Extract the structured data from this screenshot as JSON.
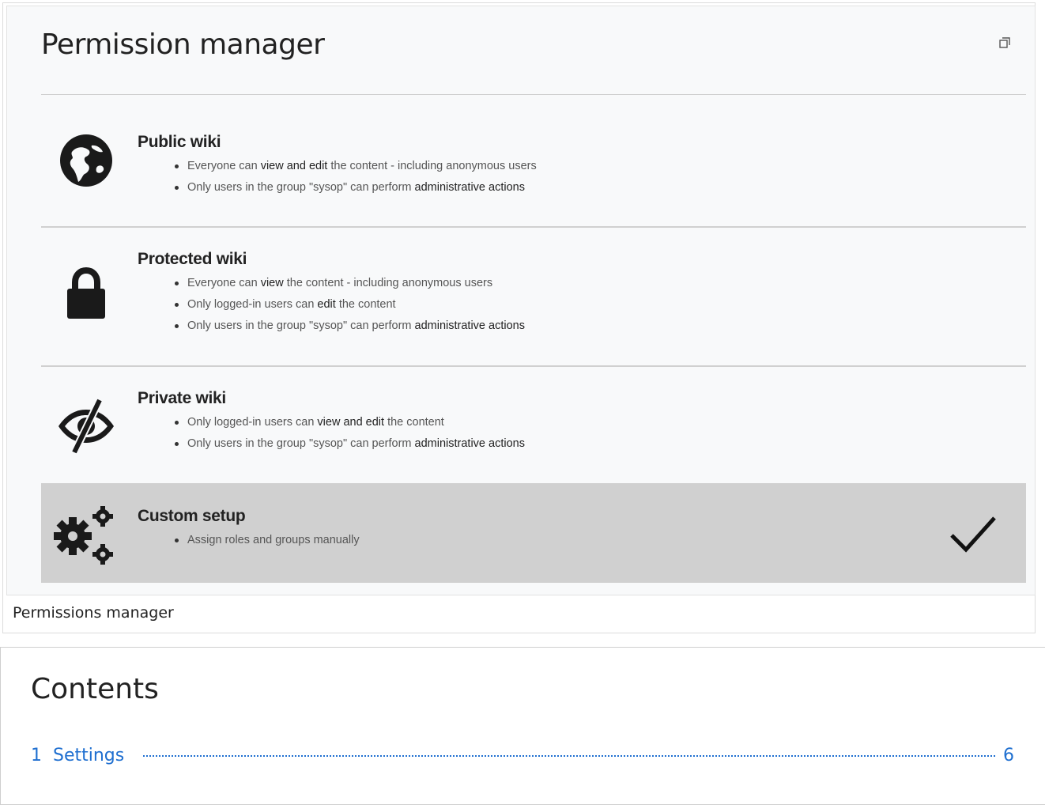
{
  "figure": {
    "title": "Permission manager",
    "caption": "Permissions manager",
    "options": [
      {
        "title": "Public wiki",
        "icon": "globe-icon",
        "items": [
          {
            "pre": "Everyone can ",
            "bold": "view and edit",
            "post": " the content - including anonymous users"
          },
          {
            "pre": "Only users in the group \"sysop\" can perform ",
            "bold": "administrative actions",
            "post": ""
          }
        ]
      },
      {
        "title": "Protected wiki",
        "icon": "lock-icon",
        "items": [
          {
            "pre": "Everyone can ",
            "bold": "view",
            "post": " the content - including anonymous users"
          },
          {
            "pre": "Only logged-in users can ",
            "bold": "edit",
            "post": " the content"
          },
          {
            "pre": "Only users in the group \"sysop\" can perform ",
            "bold": "administrative actions",
            "post": ""
          }
        ]
      },
      {
        "title": "Private wiki",
        "icon": "eye-slash-icon",
        "items": [
          {
            "pre": "Only logged-in users can ",
            "bold": "view and edit",
            "post": " the content"
          },
          {
            "pre": "Only users in the group \"sysop\" can perform ",
            "bold": "administrative actions",
            "post": ""
          }
        ]
      },
      {
        "title": "Custom setup",
        "icon": "gears-icon",
        "selected": true,
        "items": [
          {
            "pre": "Assign roles and groups manually",
            "bold": "",
            "post": ""
          }
        ]
      }
    ]
  },
  "toc": {
    "title": "Contents",
    "entries": [
      {
        "number": "1",
        "label": "Settings",
        "page": "6"
      }
    ]
  },
  "colors": {
    "link": "#1f6fd0",
    "selected_bg": "#d0d0d0",
    "panel_bg": "#f8f9fa"
  }
}
